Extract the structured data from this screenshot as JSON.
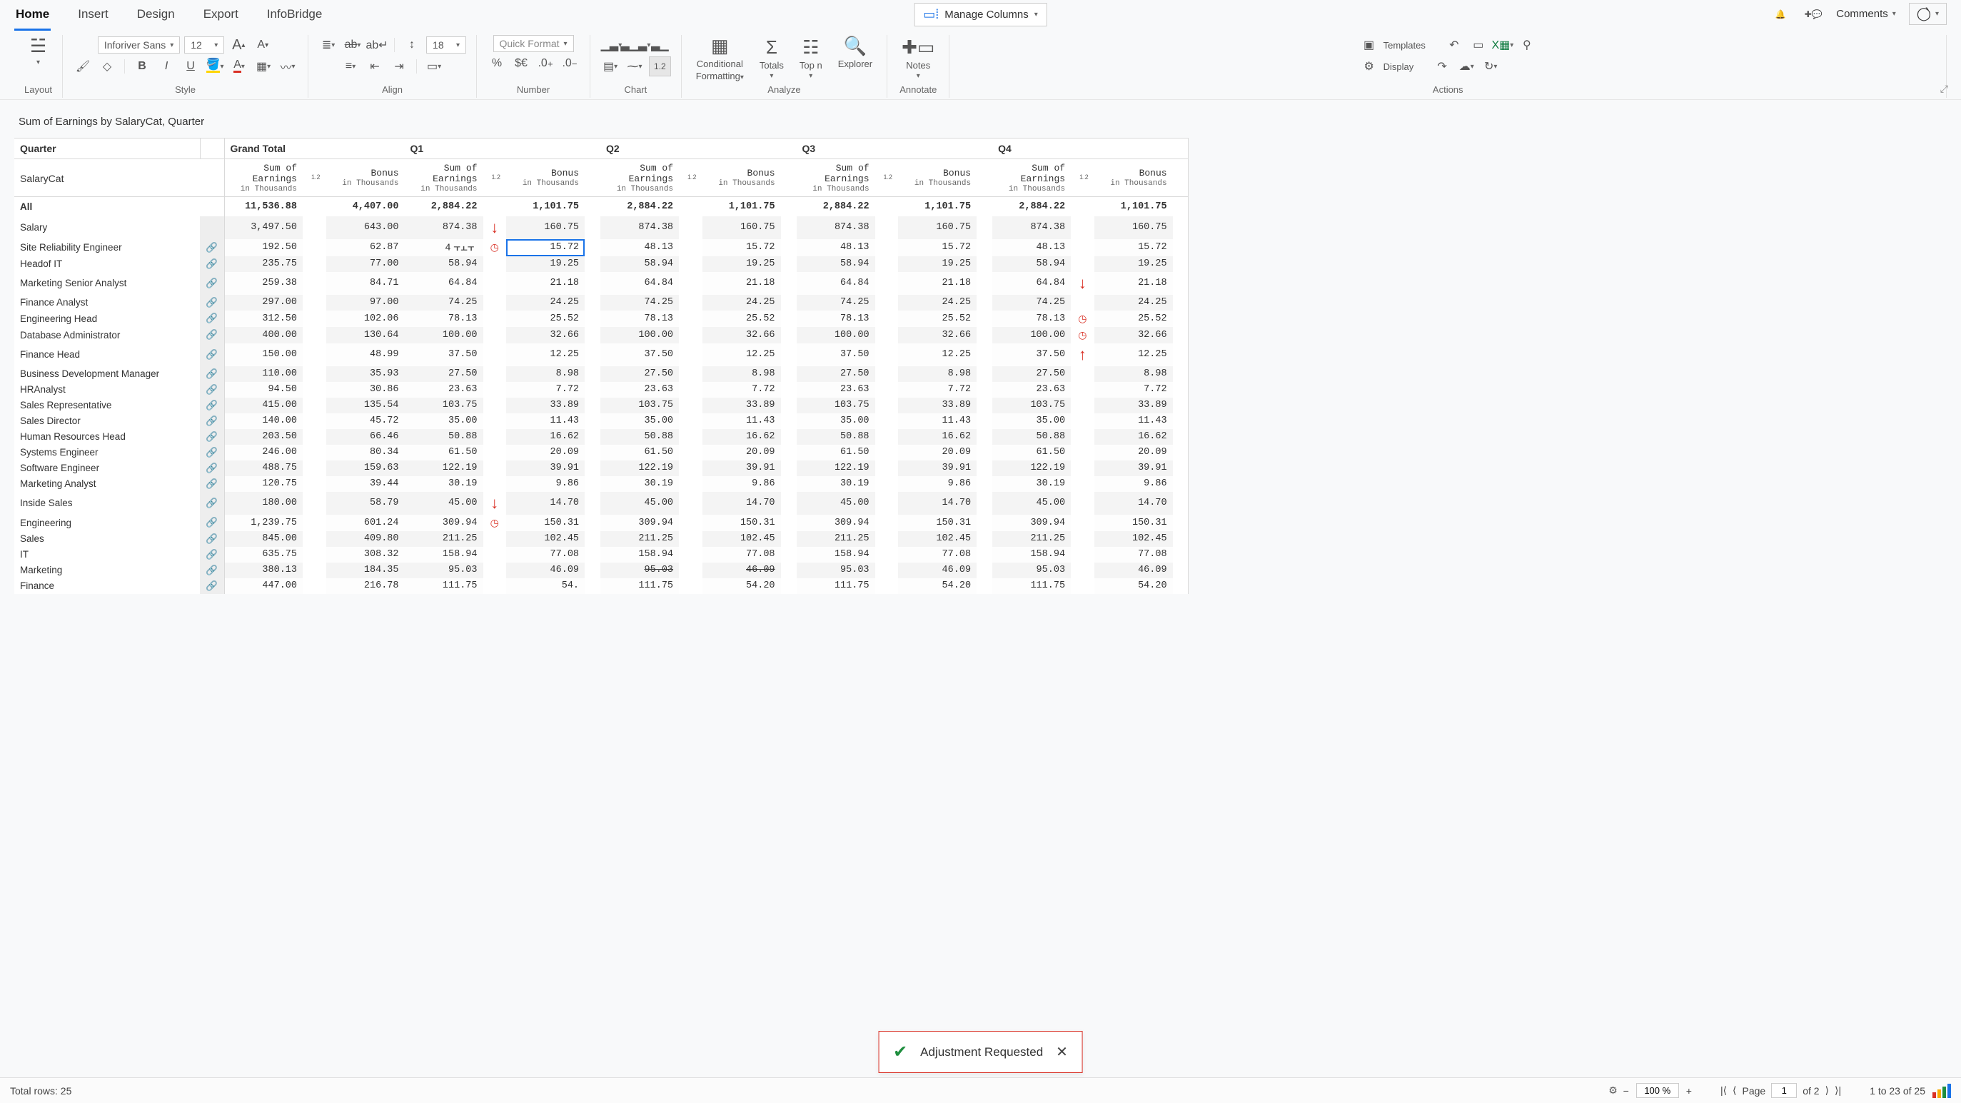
{
  "tabs": [
    "Home",
    "Insert",
    "Design",
    "Export",
    "InfoBridge"
  ],
  "active_tab": "Home",
  "manage_columns": "Manage Columns",
  "comments_label": "Comments",
  "ribbon": {
    "font_family": "Inforiver Sans",
    "font_size": "12",
    "line_height": "18",
    "quick_format": "Quick Format",
    "onep2": "1.2",
    "templates": "Templates",
    "display": "Display",
    "groups": {
      "layout": "Layout",
      "style": "Style",
      "align": "Align",
      "number": "Number",
      "chart": "Chart",
      "analyze": "Analyze",
      "annotate": "Annotate",
      "actions": "Actions"
    },
    "analyze": {
      "conditional": "Conditional",
      "formatting": "Formatting",
      "totals": "Totals",
      "topn": "Top n",
      "explorer": "Explorer"
    },
    "notes": "Notes"
  },
  "report_title": "Sum of Earnings by SalaryCat, Quarter",
  "headers": {
    "row_dim": "Quarter",
    "cat_dim": "SalaryCat",
    "grand_total": "Grand Total",
    "quarters": [
      "Q1",
      "Q2",
      "Q3",
      "Q4"
    ],
    "measure_a_top": "Sum of",
    "measure_a_mid": "Earnings",
    "measure_a_bot": "in Thousands",
    "measure_b_top": "Bonus",
    "measure_b_bot": "in Thousands",
    "onep2": "1.2",
    "all": "All"
  },
  "all_row": {
    "earn": "11,536.88",
    "bonus": "4,407.00",
    "q": {
      "earn": "2,884.22",
      "bonus": "1,101.75"
    }
  },
  "rows": [
    {
      "cat": "Salary",
      "link": false,
      "gt_e": "3,497.50",
      "gt_b": "643.00",
      "q_e": "874.38",
      "q_b": "160.75"
    },
    {
      "cat": "Site Reliability Engineer",
      "link": true,
      "gt_e": "192.50",
      "gt_b": "62.87",
      "q_e": "48.13",
      "q_b": "15.72",
      "q1_e_display": "4",
      "q1_selected": true,
      "q1_clock": true
    },
    {
      "cat": "Headof IT",
      "link": true,
      "gt_e": "235.75",
      "gt_b": "77.00",
      "q_e": "58.94",
      "q_b": "19.25"
    },
    {
      "cat": "Marketing Senior Analyst",
      "link": true,
      "gt_e": "259.38",
      "gt_b": "84.71",
      "q_e": "64.84",
      "q_b": "21.18"
    },
    {
      "cat": "Finance Analyst",
      "link": true,
      "gt_e": "297.00",
      "gt_b": "97.00",
      "q_e": "74.25",
      "q_b": "24.25"
    },
    {
      "cat": "Engineering Head",
      "link": true,
      "gt_e": "312.50",
      "gt_b": "102.06",
      "q_e": "78.13",
      "q_b": "25.52",
      "q4_clock_e": true
    },
    {
      "cat": "Database Administrator",
      "link": true,
      "gt_e": "400.00",
      "gt_b": "130.64",
      "q_e": "100.00",
      "q_b": "32.66",
      "q4_clock_e": true
    },
    {
      "cat": "Finance Head",
      "link": true,
      "gt_e": "150.00",
      "gt_b": "48.99",
      "q_e": "37.50",
      "q_b": "12.25"
    },
    {
      "cat": "Business Development Manager",
      "link": true,
      "gt_e": "110.00",
      "gt_b": "35.93",
      "q_e": "27.50",
      "q_b": "8.98"
    },
    {
      "cat": "HRAnalyst",
      "link": true,
      "gt_e": "94.50",
      "gt_b": "30.86",
      "q_e": "23.63",
      "q_b": "7.72"
    },
    {
      "cat": "Sales Representative",
      "link": true,
      "gt_e": "415.00",
      "gt_b": "135.54",
      "q_e": "103.75",
      "q_b": "33.89"
    },
    {
      "cat": "Sales Director",
      "link": true,
      "gt_e": "140.00",
      "gt_b": "45.72",
      "q_e": "35.00",
      "q_b": "11.43"
    },
    {
      "cat": "Human Resources Head",
      "link": true,
      "gt_e": "203.50",
      "gt_b": "66.46",
      "q_e": "50.88",
      "q_b": "16.62"
    },
    {
      "cat": "Systems Engineer",
      "link": true,
      "gt_e": "246.00",
      "gt_b": "80.34",
      "q_e": "61.50",
      "q_b": "20.09"
    },
    {
      "cat": "Software Engineer",
      "link": true,
      "gt_e": "488.75",
      "gt_b": "159.63",
      "q_e": "122.19",
      "q_b": "39.91"
    },
    {
      "cat": "Marketing Analyst",
      "link": true,
      "gt_e": "120.75",
      "gt_b": "39.44",
      "q_e": "30.19",
      "q_b": "9.86"
    },
    {
      "cat": "Inside Sales",
      "link": true,
      "gt_e": "180.00",
      "gt_b": "58.79",
      "q_e": "45.00",
      "q_b": "14.70"
    },
    {
      "cat": "Engineering",
      "link": true,
      "gt_e": "1,239.75",
      "gt_b": "601.24",
      "q_e": "309.94",
      "q_b": "150.31",
      "q1_clock_after_e": true
    },
    {
      "cat": "Sales",
      "link": true,
      "gt_e": "845.00",
      "gt_b": "409.80",
      "q_e": "211.25",
      "q_b": "102.45"
    },
    {
      "cat": "IT",
      "link": true,
      "gt_e": "635.75",
      "gt_b": "308.32",
      "q_e": "158.94",
      "q_b": "77.08"
    },
    {
      "cat": "Marketing",
      "link": true,
      "gt_e": "380.13",
      "gt_b": "184.35",
      "q_e": "95.03",
      "q_b": "46.09",
      "strike_q2": true
    },
    {
      "cat": "Finance",
      "link": true,
      "gt_e": "447.00",
      "gt_b": "216.78",
      "q_e": "111.75",
      "q_b": "54.20",
      "q1_b_display": "54."
    }
  ],
  "arrows": {
    "q1_down_rows": [
      0,
      16
    ],
    "q4_down_rows": [
      3
    ],
    "q4_up_rows": [
      7
    ]
  },
  "toast": {
    "text": "Adjustment Requested"
  },
  "status": {
    "total_rows": "Total rows: 25",
    "zoom": "100 %",
    "page_lbl": "Page",
    "page": "1",
    "of": "of 2",
    "range": "1 to 23 of 25"
  }
}
